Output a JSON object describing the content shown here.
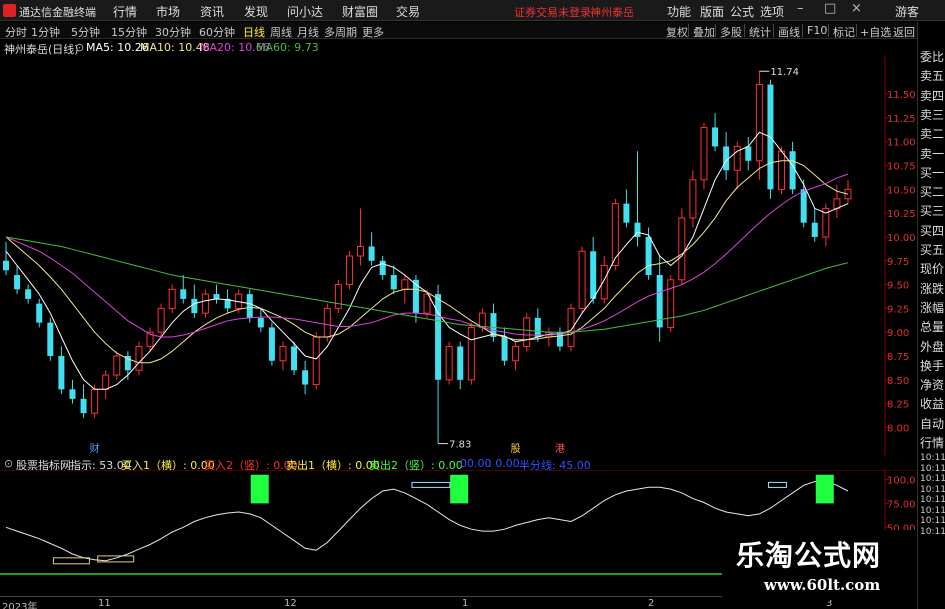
{
  "topbar": {
    "app_title": "通达信金融终端",
    "menus": [
      "行情",
      "市场",
      "资讯",
      "发现",
      "问小达",
      "财富圈",
      "交易"
    ],
    "warning": "证券交易未登录",
    "stock_name": "神州泰岳",
    "right_menus": [
      "功能",
      "版面",
      "公式",
      "选项"
    ],
    "guest": "游客"
  },
  "toolbar": {
    "periods": [
      "分时",
      "1分钟",
      "5分钟",
      "15分钟",
      "30分钟",
      "60分钟",
      "日线",
      "周线",
      "月线",
      "多周期",
      "更多"
    ],
    "active_period": "日线",
    "tools": [
      "复权",
      "叠加",
      "多股",
      "统计",
      "画线",
      "F10",
      "标记",
      "+自选",
      "返回"
    ]
  },
  "ma_line": {
    "stock_label": "神州泰岳(日线)",
    "ma5": "MA5: 10.26",
    "ma10": "MA10: 10.48",
    "ma20": "MA20: 10.66",
    "ma60": "MA60: 9.73",
    "colors": {
      "ma5": "#ffffff",
      "ma10": "#f0e68c",
      "ma20": "#e040e0",
      "ma60": "#40c040"
    }
  },
  "right_panel": {
    "items": [
      "委比",
      "卖五",
      "卖四",
      "卖三",
      "卖二",
      "卖一",
      "买一",
      "买二",
      "买三",
      "买四",
      "买五",
      "现价",
      "涨跌",
      "涨幅",
      "总量",
      "外盘",
      "换手",
      "净资",
      "收益",
      "自动",
      "行情",
      "10:11",
      "10:11",
      "10:11",
      "10:11",
      "10:11",
      "10:11",
      "10:11",
      "10:11"
    ]
  },
  "indicator_line": {
    "name": "股票指标网",
    "hint": "指示: 53.00",
    "buy1": "买入1（横）: 0.00",
    "buy2": "买入2（竖）: 0.00",
    "sell1": "卖出1（横）: 0.00",
    "sell2": "卖出2（竖）: 0.00",
    "v1": "00.00",
    "v2": ": 0.00",
    "half": "半分线: 45.00"
  },
  "price_axis": [
    "11.50",
    "11.25",
    "11.00",
    "10.75",
    "10.50",
    "10.25",
    "10.00",
    "9.75",
    "9.50",
    "9.25",
    "9.00",
    "8.75",
    "8.50",
    "8.25",
    "8.00"
  ],
  "price_top_label": "11.74",
  "sub_axis": [
    "100.0",
    "75.00",
    "50.00"
  ],
  "annotations": {
    "max": "11.74",
    "min": "7.83",
    "tag_cai": "财",
    "tag_gu": "股",
    "tag_gang": "港"
  },
  "x_axis": [
    "2023年",
    "11",
    "12",
    "1",
    "2",
    "3"
  ],
  "watermark": {
    "title": "乐淘公式网",
    "url": "www.60lt.com"
  },
  "chart_data": {
    "type": "candlestick",
    "title": "神州泰岳(日线)",
    "ylim": [
      7.7,
      11.9
    ],
    "ohlc": [
      [
        9.75,
        9.95,
        9.6,
        9.65
      ],
      [
        9.6,
        9.7,
        9.4,
        9.45
      ],
      [
        9.45,
        9.5,
        9.3,
        9.35
      ],
      [
        9.3,
        9.35,
        9.05,
        9.1
      ],
      [
        9.1,
        9.15,
        8.7,
        8.75
      ],
      [
        8.75,
        8.85,
        8.35,
        8.4
      ],
      [
        8.4,
        8.5,
        8.25,
        8.3
      ],
      [
        8.3,
        8.45,
        8.1,
        8.15
      ],
      [
        8.15,
        8.45,
        8.1,
        8.4
      ],
      [
        8.4,
        8.6,
        8.3,
        8.55
      ],
      [
        8.55,
        8.8,
        8.5,
        8.75
      ],
      [
        8.75,
        8.8,
        8.5,
        8.6
      ],
      [
        8.6,
        8.9,
        8.55,
        8.85
      ],
      [
        8.85,
        9.05,
        8.8,
        9.0
      ],
      [
        9.0,
        9.3,
        8.95,
        9.25
      ],
      [
        9.25,
        9.5,
        9.2,
        9.45
      ],
      [
        9.45,
        9.6,
        9.3,
        9.35
      ],
      [
        9.35,
        9.5,
        9.15,
        9.2
      ],
      [
        9.2,
        9.45,
        9.15,
        9.4
      ],
      [
        9.4,
        9.5,
        9.3,
        9.35
      ],
      [
        9.35,
        9.45,
        9.2,
        9.25
      ],
      [
        9.25,
        9.45,
        9.2,
        9.4
      ],
      [
        9.4,
        9.45,
        9.1,
        9.15
      ],
      [
        9.15,
        9.25,
        9.0,
        9.05
      ],
      [
        9.05,
        9.1,
        8.65,
        8.7
      ],
      [
        8.7,
        8.9,
        8.6,
        8.85
      ],
      [
        8.85,
        8.9,
        8.55,
        8.6
      ],
      [
        8.6,
        8.7,
        8.35,
        8.45
      ],
      [
        8.45,
        9.0,
        8.4,
        8.95
      ],
      [
        8.95,
        9.3,
        8.9,
        9.25
      ],
      [
        9.25,
        9.55,
        9.2,
        9.5
      ],
      [
        9.5,
        9.85,
        9.45,
        9.8
      ],
      [
        9.8,
        10.3,
        9.7,
        9.9
      ],
      [
        9.9,
        10.05,
        9.7,
        9.75
      ],
      [
        9.75,
        9.8,
        9.55,
        9.6
      ],
      [
        9.6,
        9.7,
        9.4,
        9.45
      ],
      [
        9.45,
        9.6,
        9.3,
        9.55
      ],
      [
        9.55,
        9.6,
        9.1,
        9.2
      ],
      [
        9.2,
        9.45,
        9.15,
        9.4
      ],
      [
        9.4,
        9.5,
        7.83,
        8.5
      ],
      [
        8.5,
        8.9,
        8.45,
        8.85
      ],
      [
        8.85,
        8.9,
        8.4,
        8.5
      ],
      [
        8.5,
        9.1,
        8.45,
        9.05
      ],
      [
        9.05,
        9.25,
        9.0,
        9.2
      ],
      [
        9.2,
        9.3,
        8.9,
        8.95
      ],
      [
        8.95,
        9.05,
        8.65,
        8.7
      ],
      [
        8.7,
        8.9,
        8.6,
        8.85
      ],
      [
        8.85,
        9.2,
        8.8,
        9.15
      ],
      [
        9.15,
        9.25,
        8.9,
        8.95
      ],
      [
        8.95,
        9.05,
        8.85,
        9.0
      ],
      [
        9.0,
        9.05,
        8.8,
        8.85
      ],
      [
        8.85,
        9.3,
        8.8,
        9.25
      ],
      [
        9.25,
        9.9,
        9.2,
        9.85
      ],
      [
        9.85,
        10.0,
        9.3,
        9.35
      ],
      [
        9.35,
        9.8,
        9.3,
        9.7
      ],
      [
        9.7,
        10.4,
        9.65,
        10.35
      ],
      [
        10.35,
        10.5,
        10.1,
        10.15
      ],
      [
        10.15,
        10.9,
        9.9,
        10.0
      ],
      [
        10.0,
        10.1,
        9.55,
        9.6
      ],
      [
        9.6,
        9.8,
        8.9,
        9.05
      ],
      [
        9.05,
        9.6,
        9.0,
        9.55
      ],
      [
        9.55,
        10.3,
        9.5,
        10.2
      ],
      [
        10.2,
        10.7,
        10.1,
        10.6
      ],
      [
        10.6,
        11.2,
        10.5,
        11.15
      ],
      [
        11.15,
        11.3,
        10.9,
        10.95
      ],
      [
        10.95,
        11.1,
        10.6,
        10.7
      ],
      [
        10.7,
        11.0,
        10.5,
        10.95
      ],
      [
        10.95,
        11.05,
        10.7,
        10.8
      ],
      [
        10.8,
        11.74,
        10.6,
        11.6
      ],
      [
        11.6,
        11.65,
        10.4,
        10.5
      ],
      [
        10.5,
        10.95,
        10.45,
        10.9
      ],
      [
        10.9,
        11.0,
        10.45,
        10.5
      ],
      [
        10.5,
        10.6,
        10.1,
        10.15
      ],
      [
        10.15,
        10.3,
        9.95,
        10.0
      ],
      [
        10.0,
        10.35,
        9.9,
        10.3
      ],
      [
        10.3,
        10.55,
        10.2,
        10.4
      ],
      [
        10.4,
        10.6,
        10.35,
        10.5
      ]
    ],
    "ma_series": [
      {
        "name": "MA5",
        "values": [
          9.85,
          9.7,
          9.55,
          9.4,
          9.2,
          8.95,
          8.7,
          8.5,
          8.4,
          8.4,
          8.45,
          8.55,
          8.68,
          8.8,
          8.95,
          9.1,
          9.22,
          9.3,
          9.33,
          9.35,
          9.34,
          9.32,
          9.3,
          9.25,
          9.12,
          9.0,
          8.88,
          8.75,
          8.72,
          8.85,
          9.05,
          9.25,
          9.5,
          9.68,
          9.72,
          9.68,
          9.6,
          9.5,
          9.42,
          9.2,
          9.05,
          8.98,
          8.92,
          8.95,
          8.98,
          8.96,
          8.9,
          8.92,
          8.95,
          8.98,
          8.98,
          9.02,
          9.2,
          9.35,
          9.55,
          9.78,
          9.92,
          10.05,
          10.02,
          9.8,
          9.7,
          9.8,
          10.0,
          10.3,
          10.6,
          10.8,
          10.9,
          10.95,
          11.1,
          11.05,
          10.9,
          10.75,
          10.55,
          10.3,
          10.25,
          10.3,
          10.35
        ]
      },
      {
        "name": "MA10",
        "values": [
          10.0,
          9.9,
          9.8,
          9.7,
          9.58,
          9.45,
          9.3,
          9.15,
          9.0,
          8.88,
          8.78,
          8.72,
          8.68,
          8.68,
          8.72,
          8.8,
          8.9,
          9.0,
          9.08,
          9.15,
          9.2,
          9.24,
          9.26,
          9.25,
          9.2,
          9.15,
          9.08,
          9.0,
          8.95,
          8.95,
          8.98,
          9.05,
          9.15,
          9.25,
          9.35,
          9.42,
          9.45,
          9.45,
          9.42,
          9.35,
          9.28,
          9.2,
          9.12,
          9.05,
          8.98,
          8.95,
          8.92,
          8.92,
          8.93,
          8.95,
          8.96,
          8.98,
          9.05,
          9.15,
          9.25,
          9.38,
          9.5,
          9.62,
          9.7,
          9.72,
          9.75,
          9.82,
          9.92,
          10.05,
          10.2,
          10.38,
          10.52,
          10.62,
          10.72,
          10.78,
          10.8,
          10.8,
          10.75,
          10.65,
          10.55,
          10.48,
          10.45
        ]
      },
      {
        "name": "MA20",
        "values": [
          10.0,
          9.95,
          9.9,
          9.85,
          9.78,
          9.7,
          9.62,
          9.52,
          9.42,
          9.32,
          9.22,
          9.12,
          9.05,
          8.98,
          8.95,
          8.95,
          8.97,
          9.0,
          9.04,
          9.08,
          9.12,
          9.14,
          9.15,
          9.16,
          9.16,
          9.15,
          9.14,
          9.12,
          9.1,
          9.08,
          9.06,
          9.06,
          9.08,
          9.1,
          9.14,
          9.18,
          9.2,
          9.2,
          9.19,
          9.17,
          9.14,
          9.12,
          9.08,
          9.05,
          9.02,
          9.0,
          8.98,
          8.97,
          8.97,
          8.97,
          8.98,
          9.0,
          9.03,
          9.07,
          9.12,
          9.18,
          9.25,
          9.32,
          9.38,
          9.42,
          9.46,
          9.5,
          9.56,
          9.63,
          9.72,
          9.82,
          9.93,
          10.04,
          10.15,
          10.25,
          10.34,
          10.42,
          10.48,
          10.52,
          10.56,
          10.62,
          10.66
        ]
      },
      {
        "name": "MA60",
        "values": [
          10.0,
          9.98,
          9.96,
          9.94,
          9.92,
          9.9,
          9.87,
          9.84,
          9.81,
          9.78,
          9.75,
          9.72,
          9.69,
          9.66,
          9.63,
          9.6,
          9.58,
          9.56,
          9.54,
          9.52,
          9.5,
          9.48,
          9.46,
          9.44,
          9.42,
          9.4,
          9.38,
          9.36,
          9.34,
          9.32,
          9.3,
          9.28,
          9.26,
          9.24,
          9.22,
          9.2,
          9.18,
          9.16,
          9.14,
          9.12,
          9.1,
          9.08,
          9.07,
          9.06,
          9.05,
          9.04,
          9.03,
          9.02,
          9.01,
          9.0,
          9.0,
          9.0,
          9.01,
          9.02,
          9.03,
          9.05,
          9.07,
          9.09,
          9.11,
          9.13,
          9.15,
          9.17,
          9.2,
          9.23,
          9.27,
          9.31,
          9.35,
          9.39,
          9.43,
          9.47,
          9.51,
          9.55,
          9.59,
          9.63,
          9.67,
          9.7,
          9.73
        ]
      }
    ],
    "indicator": {
      "name": "股票指标网",
      "ylim": [
        0,
        110
      ],
      "values": [
        50,
        46,
        42,
        38,
        33,
        28,
        22,
        18,
        16,
        15,
        18,
        22,
        27,
        32,
        38,
        45,
        50,
        56,
        60,
        63,
        65,
        66,
        64,
        60,
        52,
        44,
        36,
        28,
        26,
        34,
        46,
        58,
        70,
        80,
        88,
        90,
        86,
        80,
        74,
        66,
        58,
        52,
        48,
        46,
        46,
        48,
        52,
        55,
        58,
        60,
        58,
        56,
        62,
        70,
        78,
        84,
        88,
        90,
        92,
        92,
        90,
        86,
        80,
        76,
        70,
        66,
        64,
        62,
        64,
        70,
        78,
        86,
        94,
        98,
        98,
        94,
        88
      ]
    }
  }
}
